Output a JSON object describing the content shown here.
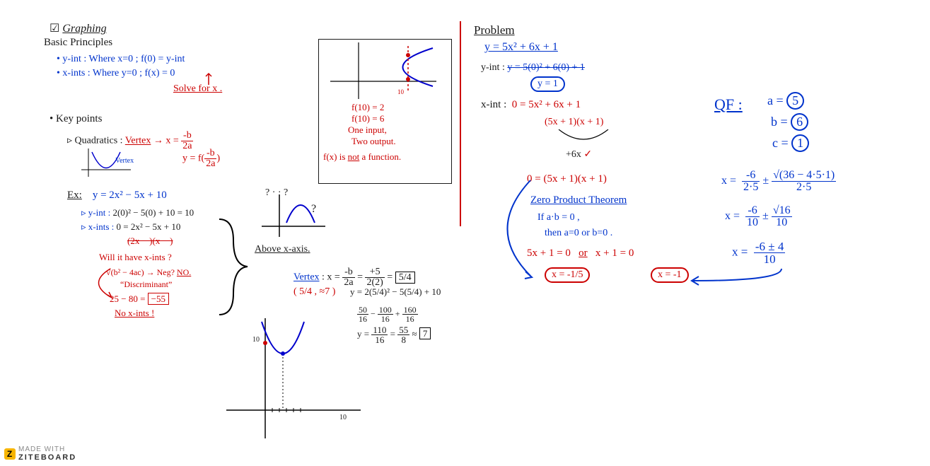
{
  "left": {
    "title_check": "☑",
    "title": "Graphing",
    "sub": "Basic Principles",
    "yint": "• y-int : Where x=0 ;  f(0) = y-int",
    "xint": "• x-ints : Where y=0 ;  f(x) = 0",
    "solve": "Solve for x .",
    "kp": "• Key points",
    "quad": "▹ Quadratics :",
    "vword": "Vertex",
    "vform1": "→ x = ",
    "vfrac_n": "-b",
    "vfrac_d": "2a",
    "vform2": "y = f(",
    "vfrac2_n": "-b",
    "vfrac2_d": "2a",
    "vform2b": ")",
    "vlabel_sketch": "Vertex",
    "ex": "Ex:",
    "exeq": "y = 2x² − 5x + 10",
    "exy": "▹ y-int :",
    "exyv": "2(0)² − 5(0) + 10 = 10",
    "exx": "▹ x-ints :",
    "exxv": "0 = 2x² − 5x + 10",
    "exstrk": "(2x −   )(x −   )",
    "q1": "Will it have x-ints ?",
    "disc1": "√(b² − 4ac)  → Neg?",
    "disc1no": "NO.",
    "disc2": "“Discriminant”",
    "disc3": "25 − 80 =",
    "disc3v": "−55",
    "disc4": "No x-ints !",
    "above": "Above x-axis.",
    "vword2": "Vertex",
    "vxeq": ": x =",
    "vx_n1": "-b",
    "vx_d1": "2a",
    "vx_eq2": "=",
    "vx_n2": "+5",
    "vx_d2": "2(2)",
    "vx_eq3": "=",
    "vx_ans": "5/4",
    "vpt": "( 5/4 , ≈7 )",
    "vy1": "y = 2(5/4)² − 5(5/4) + 10",
    "vy2a_n": "50",
    "vy2a_d": "16",
    "vy2m": " − ",
    "vy2b_n": "100",
    "vy2b_d": "16",
    "vy2p": " + ",
    "vy2c_n": "160",
    "vy2c_d": "16",
    "vy3a": "y =",
    "vy3_n1": "110",
    "vy3_d1": "16",
    "vy3_eq": " = ",
    "vy3_n2": "55",
    "vy3_d2": "8",
    "vy3_ap": " ≈ ",
    "vy3_ans": "7",
    "axis10a": "10",
    "axis10b": "10"
  },
  "boxed": {
    "f1": "f(10) = 2",
    "f2": "f(10) = 6",
    "o1": "One input,",
    "o2": "Two output.",
    "nf": "f(x) is not a function.",
    "ten": "10"
  },
  "right": {
    "title": "Problem",
    "eq": "y = 5x² + 6x + 1",
    "yint": "y-int :",
    "yintwork": "y = 5(0)² + 6(0) + 1",
    "yintans": "y = 1",
    "xint": "x-int :",
    "xintwork": "0 = 5x² + 6x + 1",
    "fac": "(5x + 1)(x + 1)",
    "midcheck": "+6x  ✓",
    "zero": "0 = (5x + 1)(x + 1)",
    "zpt": "Zero Product Theorem",
    "zpt1": "If  a·b = 0 ,",
    "zpt2": "then  a=0  or  b=0 .",
    "sol1": "5x + 1 = 0",
    "or": "or",
    "sol2": "x + 1 = 0",
    "ans1": "x = -1/5",
    "ans2": "x = -1",
    "qf": "QF :",
    "a": "a =",
    "av": "5",
    "b": "b =",
    "bv": "6",
    "c": "c =",
    "cv": "1",
    "qf1a": "x =",
    "qf1_n1": "-6",
    "qf1_d1": "2·5",
    "qf1_pm": " ± ",
    "qf1_sq": "√(36 − 4·5·1)",
    "qf1_d2": "2·5",
    "qf2a": "x =",
    "qf2_n1": "-6",
    "qf2_d1": "10",
    "qf2_pm": " ± ",
    "qf2_sq": "√16",
    "qf2_d2": "10",
    "qf3a": "x =",
    "qf3_n": "-6 ± 4",
    "qf3_d": "10"
  },
  "watermark": {
    "made": "MADE WITH",
    "brand": "ZITEBOARD"
  }
}
